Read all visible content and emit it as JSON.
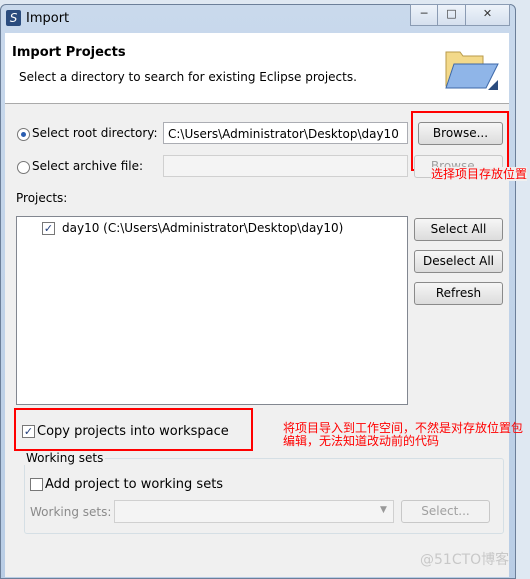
{
  "window": {
    "title": "Import",
    "app_icon": "eclipse-icon",
    "controls": [
      "minimize",
      "maximize",
      "close"
    ]
  },
  "header": {
    "title": "Import Projects",
    "description": "Select a directory to search for existing Eclipse projects.",
    "icon": "folder-open-icon"
  },
  "root": {
    "label": "Select root directory:",
    "value": "C:\\Users\\Administrator\\Desktop\\day10",
    "selected": true,
    "browse": "Browse..."
  },
  "archive": {
    "label": "Select archive file:",
    "value": "",
    "selected": false,
    "browse": "Browse..."
  },
  "projects": {
    "label": "Projects:",
    "items": [
      {
        "label": "day10 (C:\\Users\\Administrator\\Desktop\\day10)",
        "checked": true
      }
    ],
    "select_all": "Select All",
    "deselect_all": "Deselect All",
    "refresh": "Refresh"
  },
  "copy": {
    "label": "Copy projects into workspace",
    "checked": true
  },
  "working_sets": {
    "group": "Working sets",
    "add_label": "Add project to working sets",
    "add_checked": false,
    "sets_label": "Working sets:",
    "sets_value": "",
    "select": "Select..."
  },
  "annotations": {
    "browse_note": "选择项目存放位置",
    "copy_note_1": "将项目导入到工作空间，不然是对存放位置包",
    "copy_note_2": "编辑，无法知道改动前的代码",
    "color": "#ff0000"
  },
  "watermark": "@51CTO博客"
}
